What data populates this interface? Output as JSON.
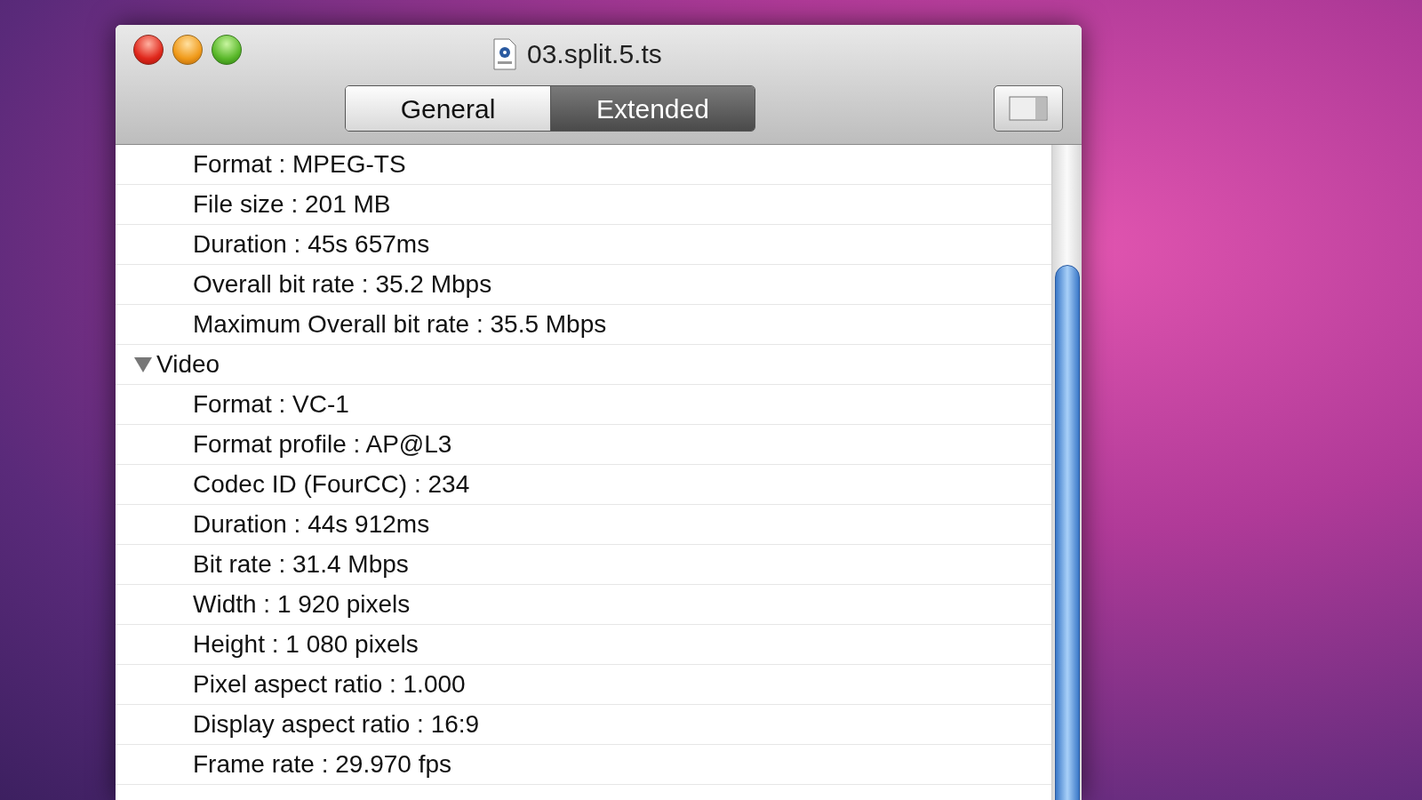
{
  "window": {
    "title": "03.split.5.ts"
  },
  "tabs": [
    {
      "label": "General",
      "selected": false
    },
    {
      "label": "Extended",
      "selected": true
    }
  ],
  "rows": [
    {
      "kind": "item",
      "text": "Format : MPEG-TS"
    },
    {
      "kind": "item",
      "text": "File size : 201 MB"
    },
    {
      "kind": "item",
      "text": "Duration : 45s 657ms"
    },
    {
      "kind": "item",
      "text": "Overall bit rate : 35.2 Mbps"
    },
    {
      "kind": "item",
      "text": "Maximum Overall bit rate : 35.5 Mbps"
    },
    {
      "kind": "section",
      "text": "Video",
      "expanded": true
    },
    {
      "kind": "item",
      "text": "Format : VC-1"
    },
    {
      "kind": "item",
      "text": "Format profile : AP@L3"
    },
    {
      "kind": "item",
      "text": "Codec ID (FourCC) : 234"
    },
    {
      "kind": "item",
      "text": "Duration : 44s 912ms"
    },
    {
      "kind": "item",
      "text": "Bit rate : 31.4 Mbps"
    },
    {
      "kind": "item",
      "text": "Width : 1 920 pixels"
    },
    {
      "kind": "item",
      "text": "Height : 1 080 pixels"
    },
    {
      "kind": "item",
      "text": "Pixel aspect ratio : 1.000"
    },
    {
      "kind": "item",
      "text": "Display aspect ratio : 16:9"
    },
    {
      "kind": "item",
      "text": "Frame rate : 29.970 fps"
    }
  ]
}
